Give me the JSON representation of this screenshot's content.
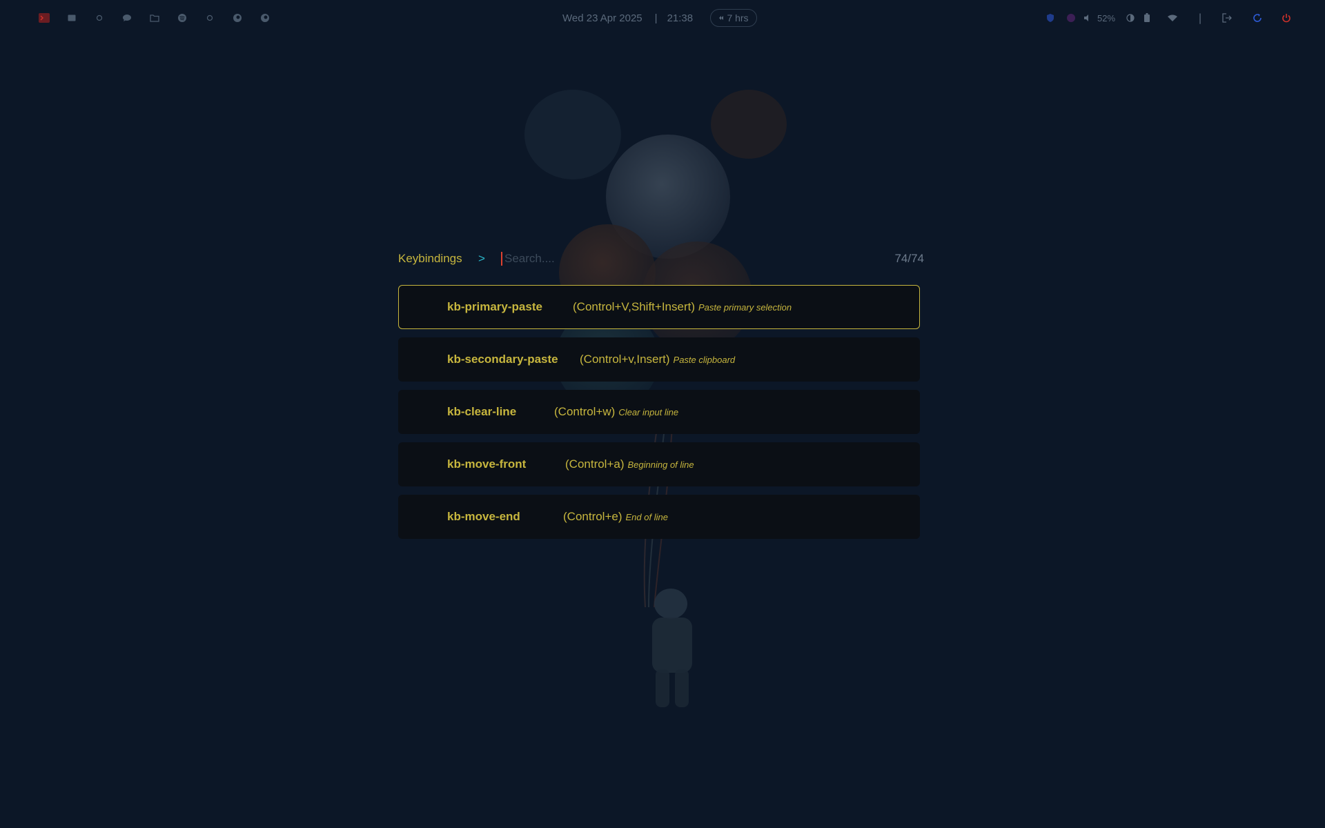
{
  "colors": {
    "background": "#0c1727",
    "accent": "#c7b63e",
    "arrow": "#2ab7c9",
    "row_bg": "#0b0f15",
    "topbar_text": "#5b6a7c",
    "danger": "#d0322b",
    "link_blue": "#2e5bd6"
  },
  "topbar": {
    "workspaces": [
      {
        "icon": "terminal-icon"
      },
      {
        "icon": "mail-icon"
      },
      {
        "icon": "circle-icon"
      },
      {
        "icon": "chat-icon"
      },
      {
        "icon": "folder-icon"
      },
      {
        "icon": "spotify-icon"
      },
      {
        "icon": "circle-icon"
      },
      {
        "icon": "firefox-icon"
      },
      {
        "icon": "firefox-icon"
      }
    ],
    "date": "Wed 23 Apr 2025",
    "separator": "|",
    "time": "21:38",
    "uptime": "7 hrs",
    "tray": {
      "volume": "52%",
      "divider": "|"
    }
  },
  "launcher": {
    "mode": "Keybindings",
    "arrow": ">",
    "search_placeholder": "Search....",
    "count": "74/74",
    "items": [
      {
        "name": "kb-primary-paste",
        "keys": "(Control+V,Shift+Insert)",
        "desc": "Paste primary selection"
      },
      {
        "name": "kb-secondary-paste",
        "keys": "(Control+v,Insert)",
        "desc": "Paste clipboard"
      },
      {
        "name": "kb-clear-line",
        "keys": "(Control+w)",
        "desc": "Clear input line"
      },
      {
        "name": "kb-move-front",
        "keys": "(Control+a)",
        "desc": "Beginning of line"
      },
      {
        "name": "kb-move-end",
        "keys": "(Control+e)",
        "desc": "End of line"
      }
    ]
  }
}
